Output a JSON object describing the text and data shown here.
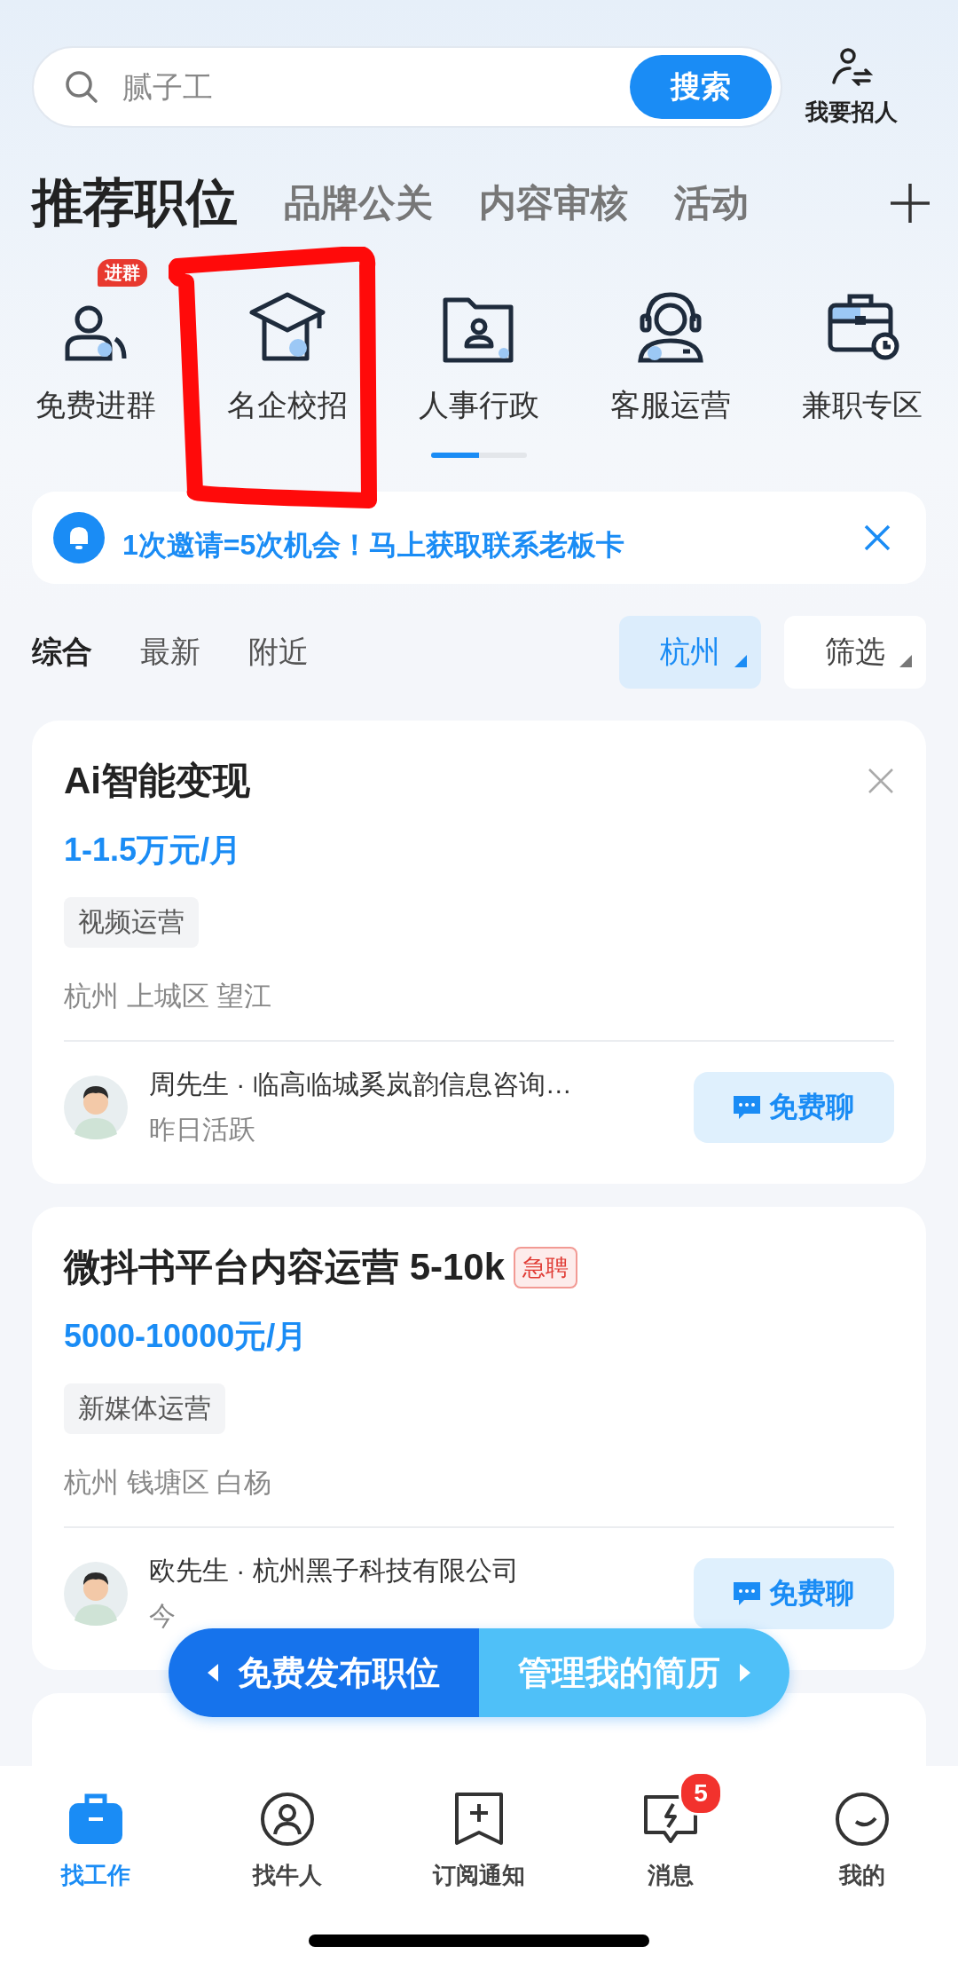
{
  "search": {
    "placeholder": "腻子工",
    "button": "搜索"
  },
  "recruit_link": {
    "label": "我要招人"
  },
  "category_tabs": [
    {
      "label": "推荐职位",
      "selected": true
    },
    {
      "label": "品牌公关",
      "selected": false
    },
    {
      "label": "内容审核",
      "selected": false
    },
    {
      "label": "活动",
      "selected": false
    }
  ],
  "quick_entries": [
    {
      "label": "免费进群",
      "kind": "group",
      "badge": "进群"
    },
    {
      "label": "名企校招",
      "kind": "graduation"
    },
    {
      "label": "人事行政",
      "kind": "folder"
    },
    {
      "label": "客服运营",
      "kind": "headset"
    },
    {
      "label": "兼职专区",
      "kind": "briefcase"
    }
  ],
  "notice": {
    "text": "1次邀请=5次机会！马上获取联系老板卡"
  },
  "sort_tabs": [
    {
      "label": "综合",
      "selected": true
    },
    {
      "label": "最新",
      "selected": false
    },
    {
      "label": "附近",
      "selected": false
    }
  ],
  "filters": [
    {
      "label": "杭州",
      "active": true
    },
    {
      "label": "筛选",
      "active": false
    }
  ],
  "jobs": [
    {
      "title": "Ai智能变现",
      "dismissible": true,
      "salary": "1-1.5万元/月",
      "tags": [
        "视频运营"
      ],
      "location": "杭州 上城区 望江",
      "recruiter": {
        "headline": "周先生 · 临高临城奚岚韵信息咨询…",
        "activity": "昨日活跃"
      },
      "chat_button": "免费聊"
    },
    {
      "title": "微抖书平台内容运营 5-10k",
      "badge": "急聘",
      "dismissible": false,
      "salary": "5000-10000元/月",
      "tags": [
        "新媒体运营"
      ],
      "location": "杭州 钱塘区 白杨",
      "recruiter": {
        "headline": "欧先生 · 杭州黑子科技有限公司",
        "activity": "今"
      },
      "chat_button": "免费聊"
    }
  ],
  "floating_actions": [
    {
      "label": "免费发布职位",
      "kind": "left"
    },
    {
      "label": "管理我的简历",
      "kind": "right"
    }
  ],
  "bottom_nav": [
    {
      "label": "找工作",
      "kind": "briefcase",
      "selected": true
    },
    {
      "label": "找牛人",
      "kind": "person",
      "selected": false
    },
    {
      "label": "订阅通知",
      "kind": "bookmark",
      "selected": false
    },
    {
      "label": "消息",
      "kind": "chat",
      "selected": false,
      "badge": "5"
    },
    {
      "label": "我的",
      "kind": "smile",
      "selected": false
    }
  ]
}
